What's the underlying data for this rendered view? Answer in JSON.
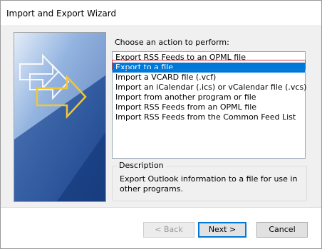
{
  "window": {
    "title": "Import and Export Wizard"
  },
  "main": {
    "prompt": "Choose an action to perform:",
    "actions": [
      {
        "label": "Export RSS Feeds to an OPML file",
        "selected": false
      },
      {
        "label": "Export to a file",
        "selected": true
      },
      {
        "label": "Import a VCARD file (.vcf)",
        "selected": false
      },
      {
        "label": "Import an iCalendar (.ics) or vCalendar file (.vcs)",
        "selected": false
      },
      {
        "label": "Import from another program or file",
        "selected": false
      },
      {
        "label": "Import RSS Feeds from an OPML file",
        "selected": false
      },
      {
        "label": "Import RSS Feeds from the Common Feed List",
        "selected": false
      }
    ],
    "description": {
      "legend": "Description",
      "text": "Export Outlook information to a file for use in other programs."
    }
  },
  "buttons": {
    "back": "< Back",
    "next": "Next >",
    "cancel": "Cancel"
  },
  "colors": {
    "selection": "#0078d7",
    "highlight_outline": "#e0303a",
    "art_blue": "#2d5aa6",
    "arrow_yellow": "#f2c634"
  }
}
